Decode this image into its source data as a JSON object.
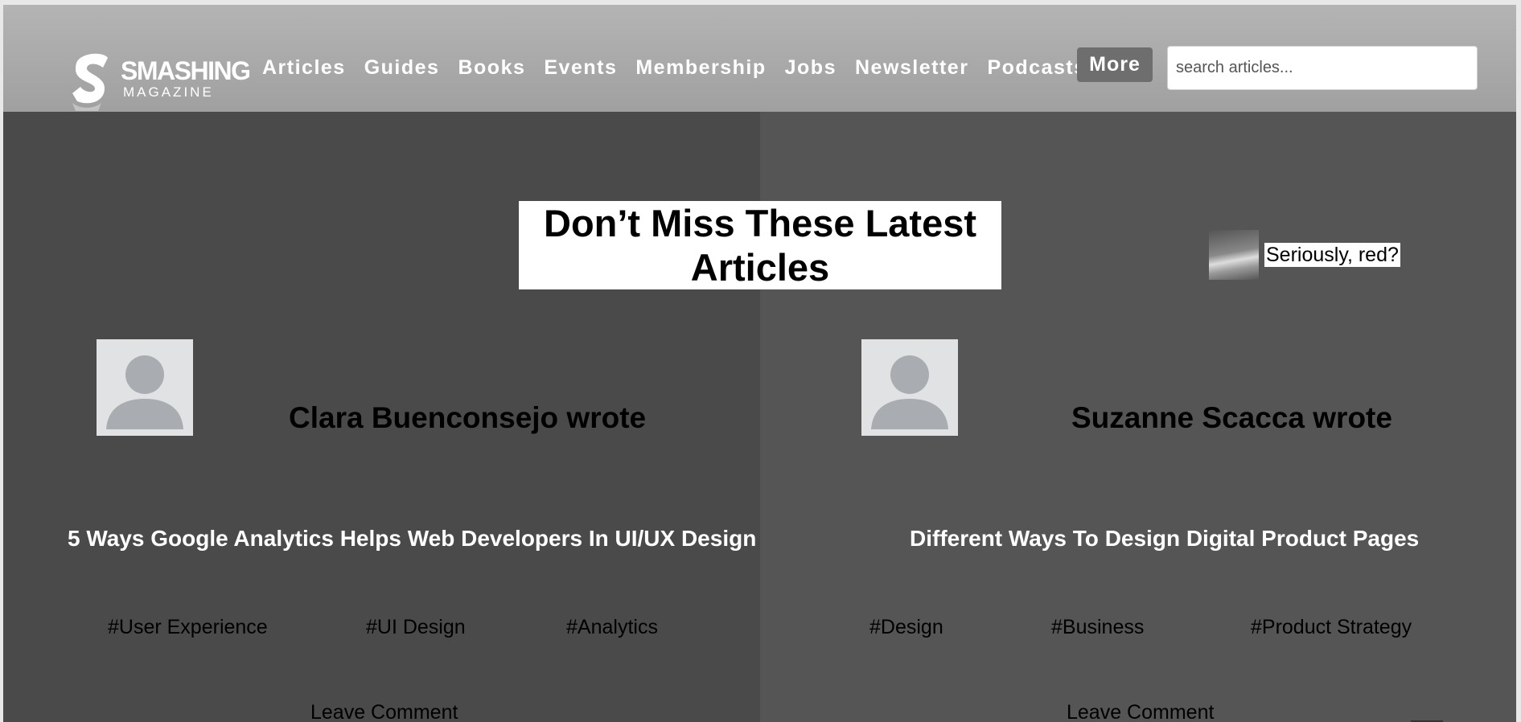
{
  "logo": {
    "word": "SMASHING",
    "sub": "MAGAZINE",
    "icon": "smashing-cat-icon"
  },
  "nav": {
    "items": [
      "Articles",
      "Guides",
      "Books",
      "Events",
      "Membership",
      "Jobs",
      "Newsletter",
      "Podcasts"
    ],
    "more_label": "More"
  },
  "search": {
    "placeholder": "search articles..."
  },
  "main": {
    "headline": "Don’t Miss These Latest Articles",
    "promo": {
      "text": "Seriously, red?",
      "thumb_icon": "landscape-thumbnail"
    }
  },
  "articles": [
    {
      "author_line": "Clara Buenconsejo wrote",
      "title": "5 Ways Google Analytics Helps Web Developers In UI/UX Design",
      "tags": [
        "#User Experience",
        "#UI Design",
        "#Analytics"
      ],
      "comment_label": "Leave Comment"
    },
    {
      "author_line": "Suzanne Scacca wrote",
      "title": "Different Ways To Design Digital Product Pages",
      "tags": [
        "#Design",
        "#Business",
        "#Product Strategy"
      ],
      "comment_label": "Leave Comment"
    }
  ],
  "colors": {
    "header_bg": "#a5a5a5",
    "left_column_bg": "#4a4a4a",
    "right_column_bg": "#555555",
    "more_button_bg": "#6e6e6e"
  }
}
